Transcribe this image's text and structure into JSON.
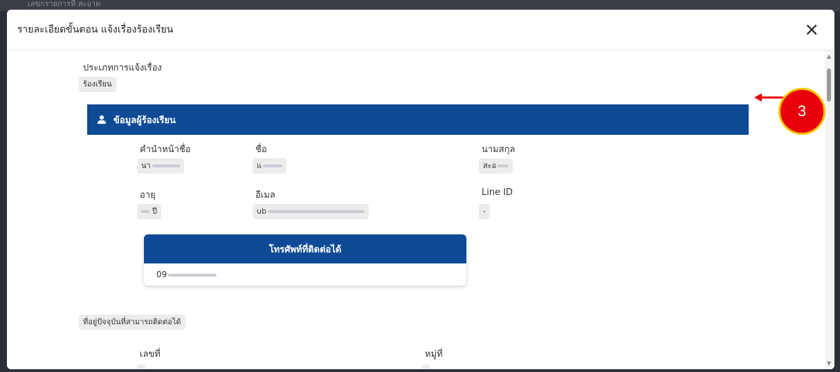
{
  "backdrop": {
    "text": "เลขกรายการที่ สะอาด"
  },
  "modal": {
    "title": "รายละเอียดขั้นตอน แจ้งเรื่องร้องเรียน",
    "close_label": "×"
  },
  "complaint_type": {
    "label": "ประเภทการแจ้งเรื่อง",
    "value": "ร้องเรียน"
  },
  "complainant_section": {
    "title": "ข้อมูลผู้ร้องเรียน",
    "icon": "person-icon",
    "fields": {
      "prefix": {
        "label": "คำนำหน้าชื่อ",
        "value": "นา"
      },
      "first_name": {
        "label": "ชื่อ",
        "value": "แ"
      },
      "last_name": {
        "label": "นามสกุล",
        "value": "สะอ"
      },
      "age": {
        "label": "อายุ",
        "value": "ปี"
      },
      "email": {
        "label": "อีเมล",
        "value": "ub"
      },
      "line_id": {
        "label": "Line ID",
        "value": "-"
      }
    }
  },
  "phone_table": {
    "header": "โทรศัพท์ที่ติดต่อได้",
    "value": "09"
  },
  "address_section": {
    "label": "ที่อยู่ปัจจุบันที่สามารถติดต่อได้",
    "house_no_label": "เลขที่",
    "village_no_label": "หมู่ที่"
  },
  "annotation": {
    "number": "3"
  },
  "colors": {
    "primary": "#0e4a96",
    "callout": "#e8000a",
    "callout_border": "#f5c400"
  }
}
